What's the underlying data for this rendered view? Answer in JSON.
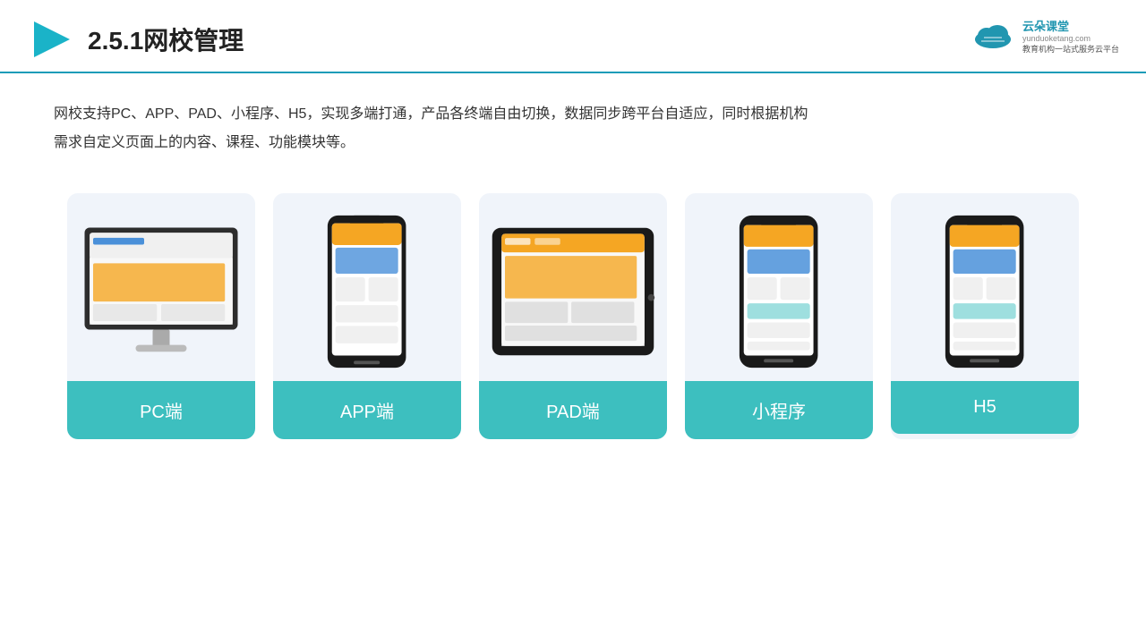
{
  "header": {
    "title": "2.5.1网校管理",
    "brand_name": "云朵课堂",
    "brand_url": "yunduoketang.com",
    "brand_tagline": "教育机构一站\n式服务云平台"
  },
  "description": "网校支持PC、APP、PAD、小程序、H5，实现多端打通，产品各终端自由切换，数据同步跨平台自适应，同时根据机构\n需求自定义页面上的内容、课程、功能模块等。",
  "cards": [
    {
      "id": "pc",
      "label": "PC端"
    },
    {
      "id": "app",
      "label": "APP端"
    },
    {
      "id": "pad",
      "label": "PAD端"
    },
    {
      "id": "mini",
      "label": "小程序"
    },
    {
      "id": "h5",
      "label": "H5"
    }
  ]
}
